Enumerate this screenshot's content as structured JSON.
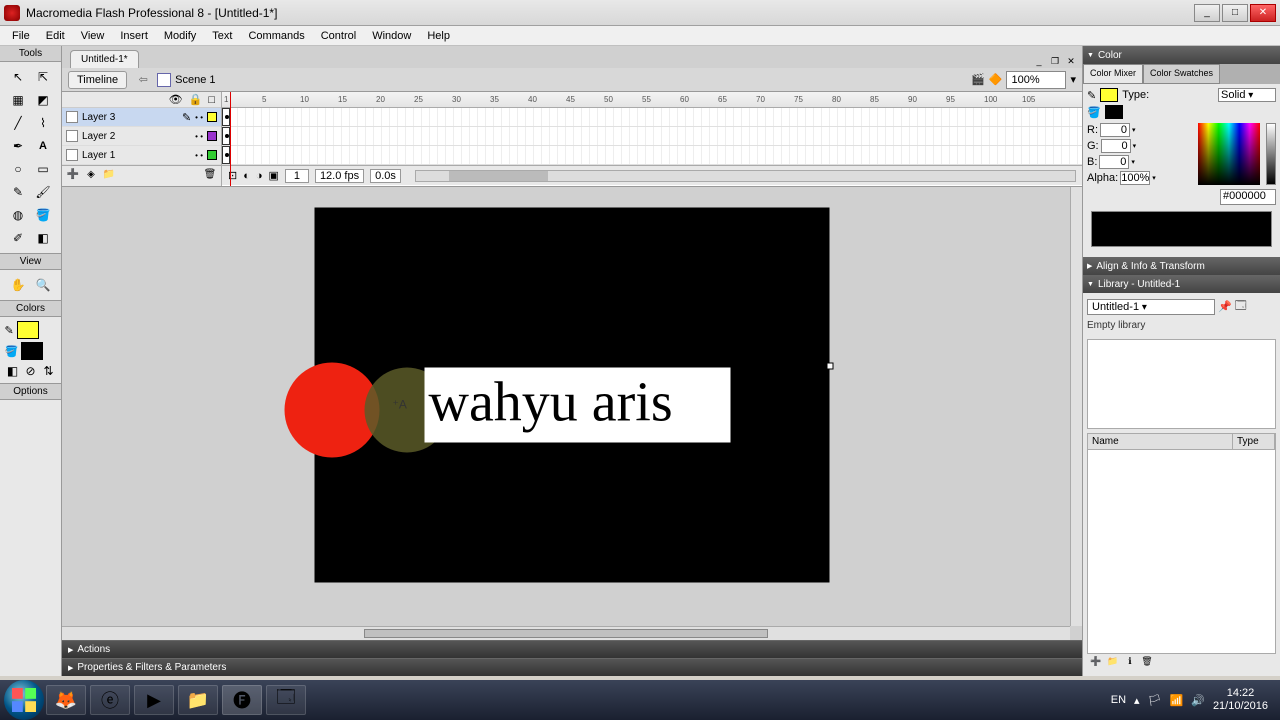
{
  "window": {
    "title": "Macromedia Flash Professional 8 - [Untitled-1*]"
  },
  "menu": [
    "File",
    "Edit",
    "View",
    "Insert",
    "Modify",
    "Text",
    "Commands",
    "Control",
    "Window",
    "Help"
  ],
  "tools_panel": {
    "tools_label": "Tools",
    "view_label": "View",
    "colors_label": "Colors",
    "options_label": "Options"
  },
  "document": {
    "tab": "Untitled-1*",
    "timeline_btn": "Timeline",
    "scene": "Scene 1",
    "zoom": "100%"
  },
  "timeline": {
    "layers": [
      {
        "name": "Layer 3",
        "color": "#ffff33",
        "active": true
      },
      {
        "name": "Layer 2",
        "color": "#9933cc",
        "active": false
      },
      {
        "name": "Layer 1",
        "color": "#33cc33",
        "active": false
      }
    ],
    "ruler_ticks": [
      1,
      5,
      10,
      15,
      20,
      25,
      30,
      35,
      40,
      45,
      50,
      55,
      60,
      65,
      70,
      75,
      80,
      85,
      90,
      95,
      100,
      105
    ],
    "status": {
      "frame": "1",
      "fps": "12.0 fps",
      "time": "0.0s"
    }
  },
  "stage": {
    "text_content": "wahyu aris"
  },
  "panels": {
    "actions": "Actions",
    "properties": "Properties & Filters & Parameters",
    "color": {
      "title": "Color",
      "tab_mixer": "Color Mixer",
      "tab_swatches": "Color Swatches",
      "type_label": "Type:",
      "type_value": "Solid",
      "r_label": "R:",
      "r_value": "0",
      "g_label": "G:",
      "g_value": "0",
      "b_label": "B:",
      "b_value": "0",
      "alpha_label": "Alpha:",
      "alpha_value": "100%",
      "hex": "#000000",
      "fill_swatch": "#ffff33",
      "stroke_swatch": "#000000"
    },
    "align": {
      "title": "Align & Info & Transform"
    },
    "library": {
      "title": "Library - Untitled-1",
      "doc_select": "Untitled-1",
      "empty_text": "Empty library",
      "col_name": "Name",
      "col_type": "Type"
    }
  },
  "taskbar": {
    "lang": "EN",
    "time": "14:22",
    "date": "21/10/2016"
  }
}
